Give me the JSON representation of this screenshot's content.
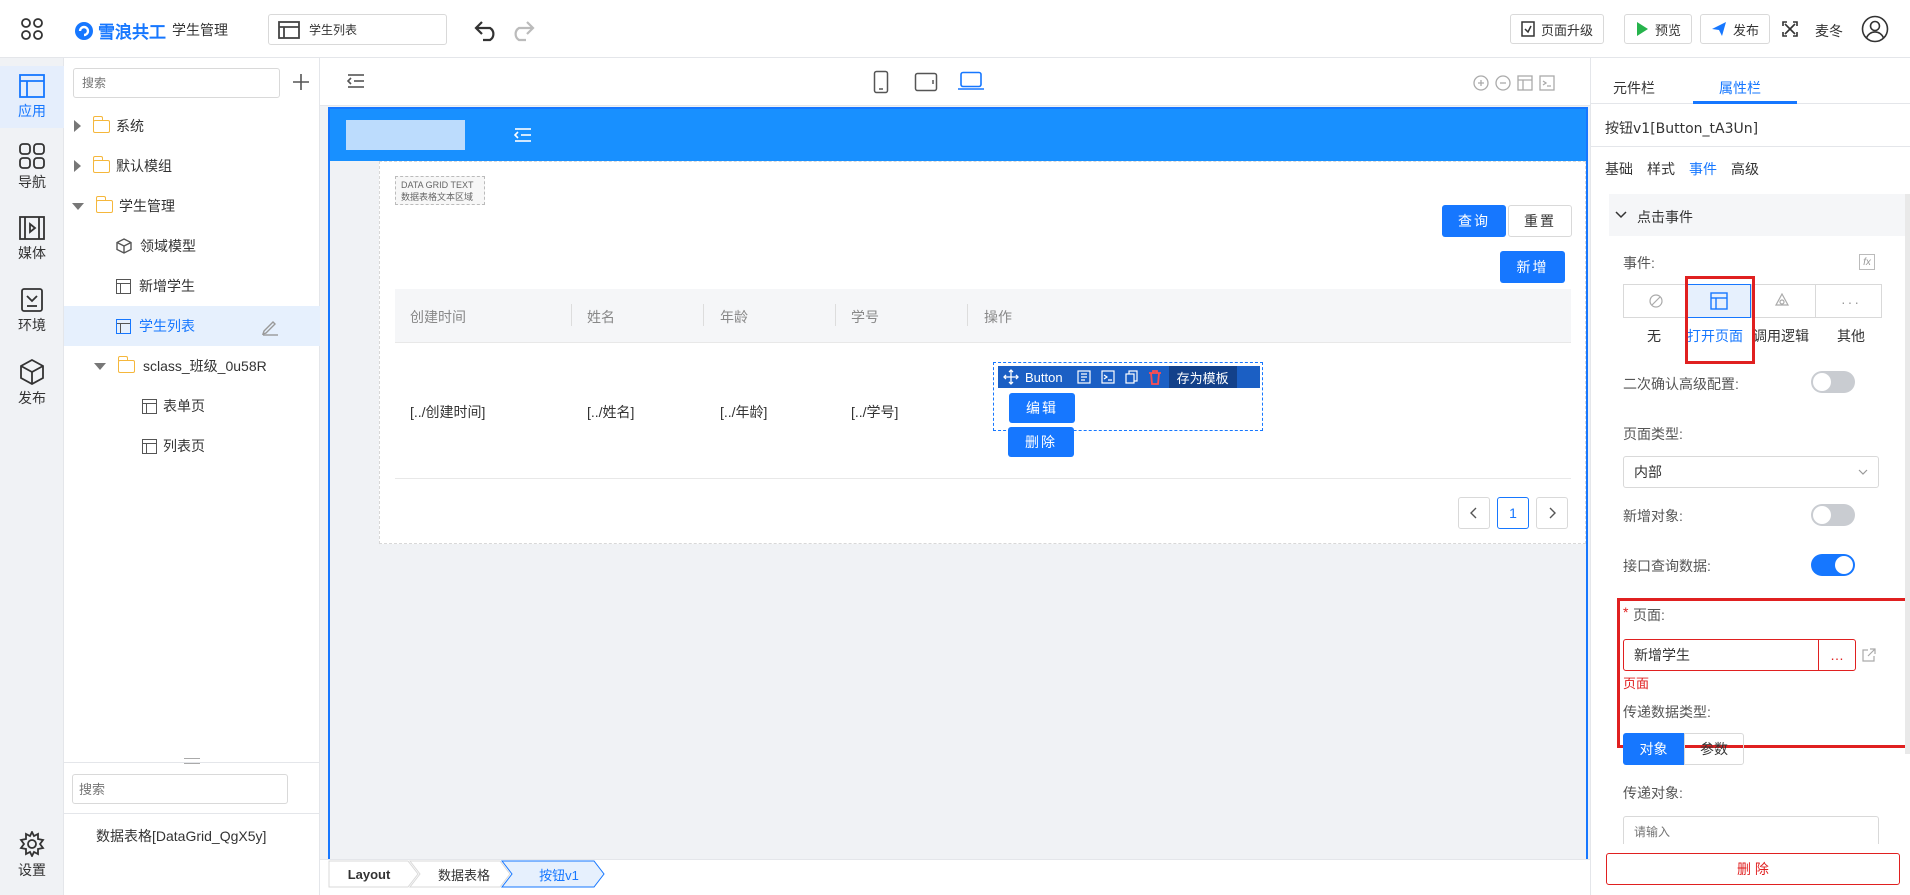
{
  "topbar": {
    "app_name": "雪浪共工",
    "module": "学生管理",
    "page_selector": "学生列表",
    "upgrade_label": "页面升级",
    "preview_label": "预览",
    "publish_label": "发布",
    "user_name": "麦冬"
  },
  "rail": {
    "items": [
      {
        "label": "应用",
        "icon": "app-icon"
      },
      {
        "label": "导航",
        "icon": "nav-grid-icon"
      },
      {
        "label": "媒体",
        "icon": "media-icon"
      },
      {
        "label": "环境",
        "icon": "env-icon"
      },
      {
        "label": "发布",
        "icon": "cube-icon"
      }
    ],
    "settings_label": "设置"
  },
  "tree": {
    "search_placeholder": "搜索",
    "items": [
      {
        "label": "系统"
      },
      {
        "label": "默认模组"
      },
      {
        "label": "学生管理"
      },
      {
        "label": "领域模型"
      },
      {
        "label": "新增学生"
      },
      {
        "label": "学生列表"
      },
      {
        "label": "sclass_班级_0u58R"
      },
      {
        "label": "表单页"
      },
      {
        "label": "列表页"
      }
    ],
    "bottom_search_placeholder": "搜索",
    "bottom_item": "数据表格[DataGrid_QgX5y]"
  },
  "canvas": {
    "grid_tag_line1": "DATA GRID TEXT",
    "grid_tag_line2": "数据表格文本区域",
    "query_label": "查询",
    "reset_label": "重置",
    "add_label": "新增",
    "columns": [
      "创建时间",
      "姓名",
      "年龄",
      "学号",
      "操作"
    ],
    "row": [
      "[../创建时间]",
      "[../姓名]",
      "[../年龄]",
      "[../学号]"
    ],
    "button_toolbar_label": "Button",
    "save_template_label": "存为模板",
    "edit_label": "编辑",
    "delete_label": "删除",
    "page_number": "1"
  },
  "breadcrumb": [
    "Layout",
    "数据表格",
    "按钮v1"
  ],
  "right": {
    "tabs": [
      "元件栏",
      "属性栏"
    ],
    "component_title": "按钮v1[Button_tA3Un]",
    "subtabs": [
      "基础",
      "样式",
      "事件",
      "高级"
    ],
    "section_title": "点击事件",
    "event_label": "事件:",
    "event_options": [
      "无",
      "打开页面",
      "调用逻辑",
      "其他"
    ],
    "confirm_label": "二次确认高级配置:",
    "page_type_label": "页面类型:",
    "page_type_value": "内部",
    "new_object_label": "新增对象:",
    "api_query_label": "接口查询数据:",
    "page_label": "页面:",
    "page_value": "新增学生",
    "page_error": "页面",
    "pass_type_label": "传递数据类型:",
    "pass_type_options": [
      "对象",
      "参数"
    ],
    "pass_object_label": "传递对象:",
    "pass_object_placeholder": "请输入",
    "delete_label": "删 除"
  },
  "colors": {
    "accent": "#1677ff",
    "danger": "#e02020",
    "folder": "#f5b73b"
  }
}
